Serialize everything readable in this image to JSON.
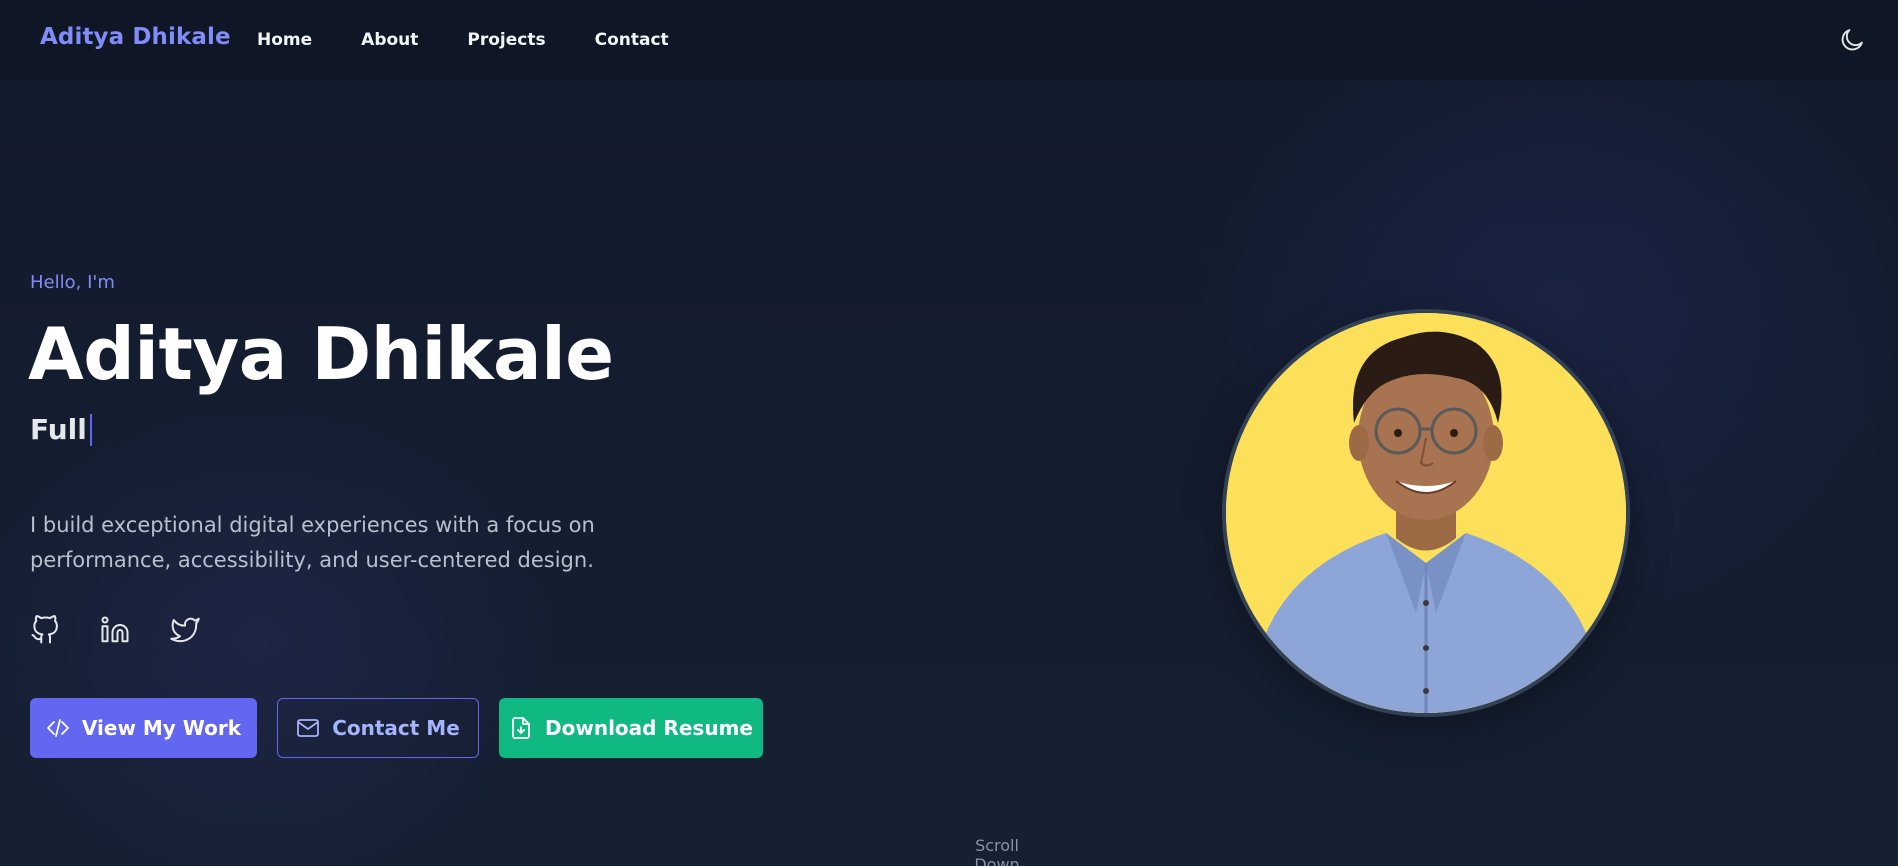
{
  "nav": {
    "brand": "Aditya Dhikale",
    "links": [
      "Home",
      "About",
      "Projects",
      "Contact"
    ],
    "theme_toggle_icon": "moon-icon"
  },
  "hero": {
    "greeting": "Hello, I'm",
    "name": "Aditya Dhikale",
    "typed_text": "Full",
    "bio": "I build exceptional digital experiences with a focus on performance, accessibility, and user-centered design.",
    "socials": [
      {
        "icon": "github-icon"
      },
      {
        "icon": "linkedin-icon"
      },
      {
        "icon": "twitter-icon"
      }
    ],
    "buttons": {
      "view_work": {
        "label": "View My Work",
        "icon": "code-icon"
      },
      "contact": {
        "label": "Contact Me",
        "icon": "mail-icon"
      },
      "resume": {
        "label": "Download Resume",
        "icon": "file-download-icon"
      }
    },
    "avatar_alt": "Aditya Dhikale"
  },
  "scroll_hint": "Scroll Down",
  "colors": {
    "background": "#111827",
    "accent": "#818cf8",
    "primary": "#6366f1",
    "success": "#10b981",
    "avatar_bg": "#fde05a"
  }
}
